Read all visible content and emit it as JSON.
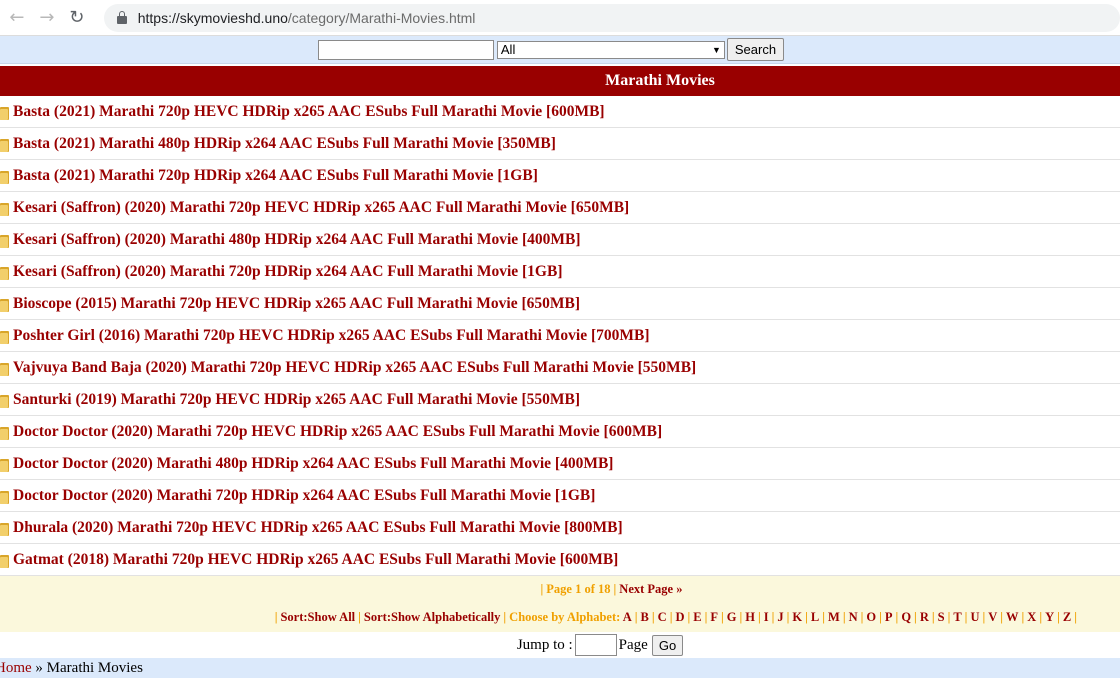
{
  "browser": {
    "url_host": "https://skymovieshd.uno",
    "url_path": "/category/Marathi-Movies.html"
  },
  "search": {
    "query": "",
    "category_selected": "All",
    "button_label": "Search"
  },
  "page_title": "Marathi Movies",
  "movies": [
    "Basta (2021) Marathi 720p HEVC HDRip x265 AAC ESubs Full Marathi Movie [600MB]",
    "Basta (2021) Marathi 480p HDRip x264 AAC ESubs Full Marathi Movie [350MB]",
    "Basta (2021) Marathi 720p HDRip x264 AAC ESubs Full Marathi Movie [1GB]",
    "Kesari (Saffron) (2020) Marathi 720p HEVC HDRip x265 AAC Full Marathi Movie [650MB]",
    "Kesari (Saffron) (2020) Marathi 480p HDRip x264 AAC Full Marathi Movie [400MB]",
    "Kesari (Saffron) (2020) Marathi 720p HDRip x264 AAC Full Marathi Movie [1GB]",
    "Bioscope (2015) Marathi 720p HEVC HDRip x265 AAC Full Marathi Movie [650MB]",
    "Poshter Girl (2016) Marathi 720p HEVC HDRip x265 AAC ESubs Full Marathi Movie [700MB]",
    "Vajvuya Band Baja (2020) Marathi 720p HEVC HDRip x265 AAC ESubs Full Marathi Movie [550MB]",
    "Santurki (2019) Marathi 720p HEVC HDRip x265 AAC Full Marathi Movie [550MB]",
    "Doctor Doctor (2020) Marathi 720p HEVC HDRip x265 AAC ESubs Full Marathi Movie [600MB]",
    "Doctor Doctor (2020) Marathi 480p HDRip x264 AAC ESubs Full Marathi Movie [400MB]",
    "Doctor Doctor (2020) Marathi 720p HDRip x264 AAC ESubs Full Marathi Movie [1GB]",
    "Dhurala (2020) Marathi 720p HEVC HDRip x265 AAC ESubs Full Marathi Movie [800MB]",
    "Gatmat (2018) Marathi 720p HEVC HDRip x265 AAC ESubs Full Marathi Movie [600MB]"
  ],
  "pagination": {
    "page_info": "Page 1 of 18",
    "next_label": "Next Page »",
    "sort_all": "Sort:Show All",
    "sort_alpha": "Sort:Show Alphabetically",
    "choose_label": "Choose by Alphabet:",
    "letters": [
      "A",
      "B",
      "C",
      "D",
      "E",
      "F",
      "G",
      "H",
      "I",
      "J",
      "K",
      "L",
      "M",
      "N",
      "O",
      "P",
      "Q",
      "R",
      "S",
      "T",
      "U",
      "V",
      "W",
      "X",
      "Y",
      "Z"
    ]
  },
  "jump": {
    "label": "Jump to :",
    "page_label": "Page",
    "go_label": "Go"
  },
  "breadcrumb": {
    "home": "Home",
    "separator": "»",
    "current": "Marathi Movies"
  },
  "colors": {
    "brand_red": "#990000",
    "orange": "#f0a000",
    "light_blue": "#dbe9fb",
    "pager_bg": "#fbf8dc"
  }
}
